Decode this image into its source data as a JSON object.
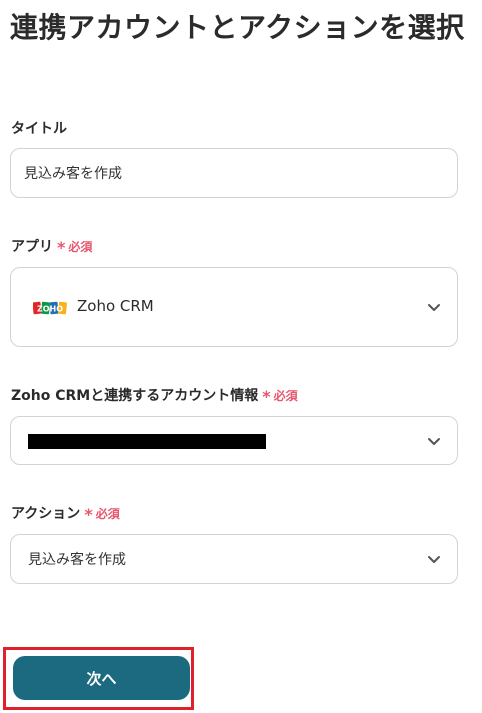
{
  "page": {
    "title": "連携アカウントとアクションを選択"
  },
  "form": {
    "title_field": {
      "label": "タイトル",
      "value": "見込み客を作成"
    },
    "app_field": {
      "label": "アプリ",
      "required_label": "必須",
      "value": "Zoho CRM",
      "logo_text": "ZOHO",
      "icon": "chevron-down-icon"
    },
    "account_field": {
      "label": "Zoho CRMと連携するアカウント情報",
      "required_label": "必須",
      "icon": "chevron-down-icon"
    },
    "action_field": {
      "label": "アクション",
      "required_label": "必須",
      "value": "見込み客を作成",
      "icon": "chevron-down-icon"
    }
  },
  "footer": {
    "next_label": "次へ"
  },
  "colors": {
    "accent": "#1c6a80",
    "required": "#e8566e",
    "highlight_frame": "#e0202a",
    "border": "#d3d3d3"
  }
}
